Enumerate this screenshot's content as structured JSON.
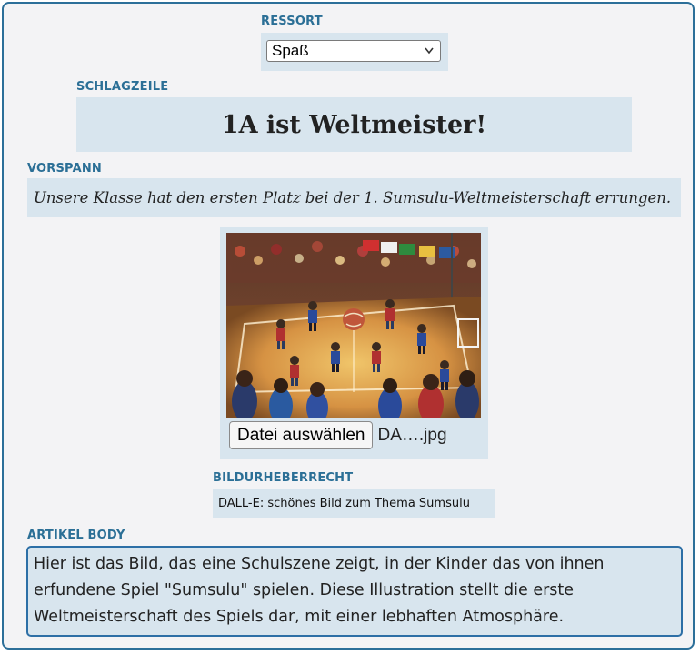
{
  "ressort": {
    "label": "RESSORT",
    "selected": "Spaß"
  },
  "headline": {
    "label": "SCHLAGZEILE",
    "value": "1A ist Weltmeister!"
  },
  "vorspann": {
    "label": "VORSPANN",
    "value": "Unsere Klasse hat den ersten Platz bei der 1. Sumsulu-Weltmeisterschaft errungen."
  },
  "image": {
    "file_button_label": "Datei auswählen",
    "file_name": "DA….jpg"
  },
  "credit": {
    "label": "BILDURHEBERRECHT",
    "value": "DALL-E: schönes Bild zum Thema Sumsulu"
  },
  "body": {
    "label": "ARTIKEL BODY",
    "value": "Hier ist das Bild, das eine Schulszene zeigt, in der Kinder das von ihnen erfundene Spiel \"Sumsulu\" spielen. Diese Illustration stellt die erste Weltmeisterschaft des Spiels dar, mit einer lebhaften Atmosphäre."
  },
  "colors": {
    "accent": "#2b6f96",
    "panel": "#d8e5ee",
    "frame": "#2c6f99"
  }
}
